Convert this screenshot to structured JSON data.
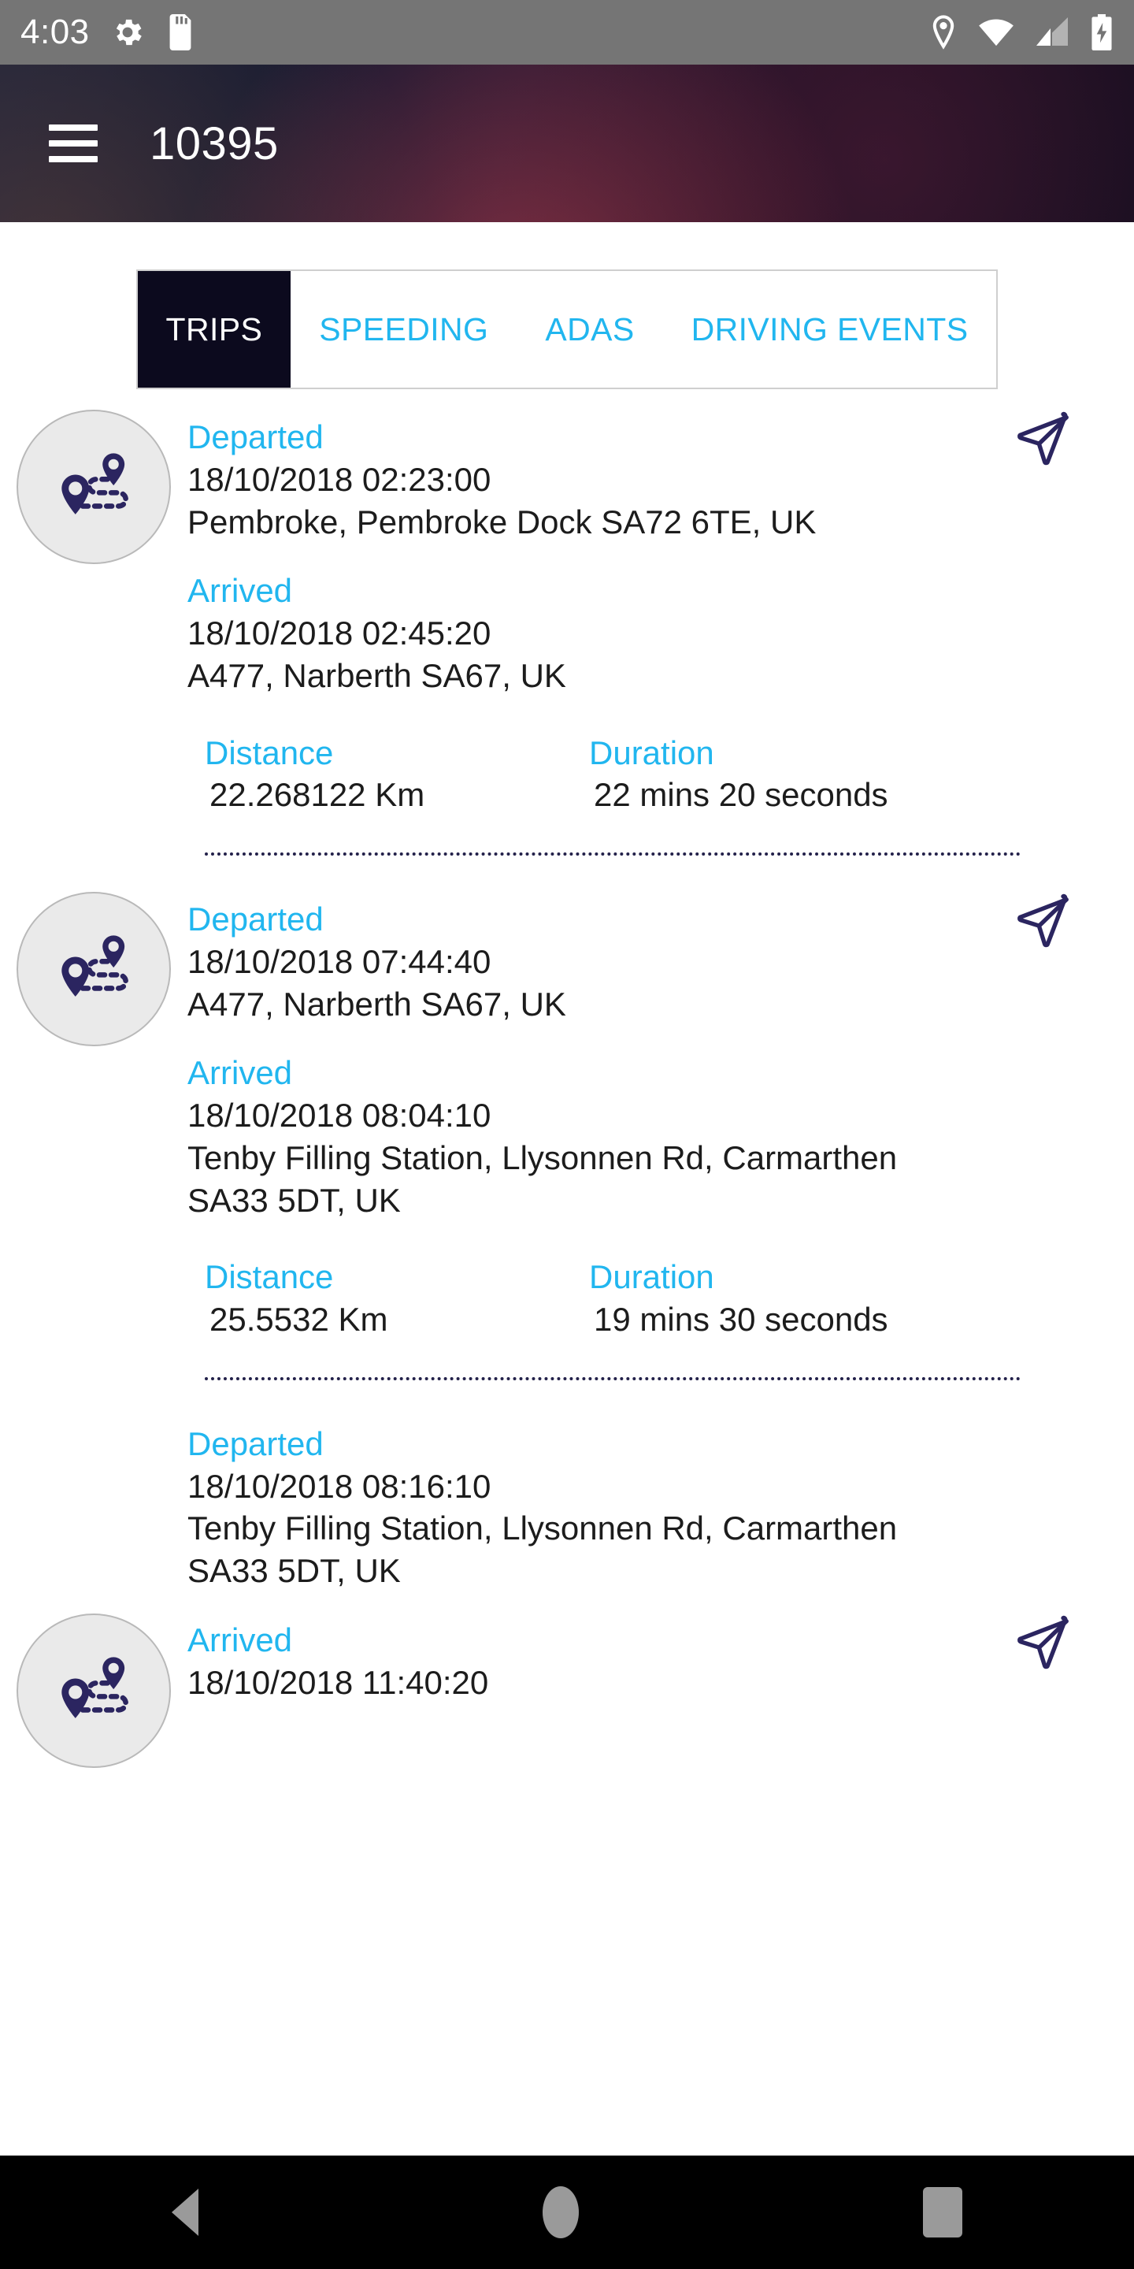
{
  "status_bar": {
    "time": "4:03",
    "left_icons": [
      "gear-icon",
      "sd-card-icon"
    ],
    "right_icons": [
      "location-pin-icon",
      "wifi-icon",
      "cellular-signal-icon",
      "battery-charging-icon"
    ]
  },
  "app_bar": {
    "menu_icon": "hamburger-menu-icon",
    "title": "10395"
  },
  "tabs": {
    "active_index": 0,
    "items": [
      {
        "label": "TRIPS"
      },
      {
        "label": "SPEEDING"
      },
      {
        "label": "ADAS"
      },
      {
        "label": "DRIVING EVENTS"
      }
    ]
  },
  "labels": {
    "departed": "Departed",
    "arrived": "Arrived",
    "distance": "Distance",
    "duration": "Duration"
  },
  "icons": {
    "trip_route": "route-pins-icon",
    "send": "send-plane-icon"
  },
  "trips": [
    {
      "departed_time": "18/10/2018 02:23:00",
      "departed_place": "Pembroke, Pembroke Dock SA72 6TE, UK",
      "arrived_time": "18/10/2018 02:45:20",
      "arrived_place": "A477, Narberth SA67, UK",
      "distance": "22.268122 Km",
      "duration": "22 mins 20 seconds"
    },
    {
      "departed_time": "18/10/2018 07:44:40",
      "departed_place": "A477, Narberth SA67, UK",
      "arrived_time": "18/10/2018 08:04:10",
      "arrived_place": "Tenby Filling Station, Llysonnen Rd, Carmarthen SA33 5DT, UK",
      "distance": "25.5532 Km",
      "duration": "19 mins 30 seconds"
    },
    {
      "departed_time": "18/10/2018 08:16:10",
      "departed_place": "Tenby Filling Station, Llysonnen Rd, Carmarthen SA33 5DT, UK",
      "arrived_time": "18/10/2018 11:40:20",
      "arrived_place": "",
      "distance": "",
      "duration": ""
    }
  ],
  "nav_bar": {
    "back": "back-icon",
    "home": "home-icon",
    "recents": "recents-icon"
  },
  "colors": {
    "accent_cyan": "#21b6ef",
    "tab_active_bg": "#0c0a1e",
    "pin_navy": "#2b2560",
    "status_bar_bg": "#757575"
  }
}
